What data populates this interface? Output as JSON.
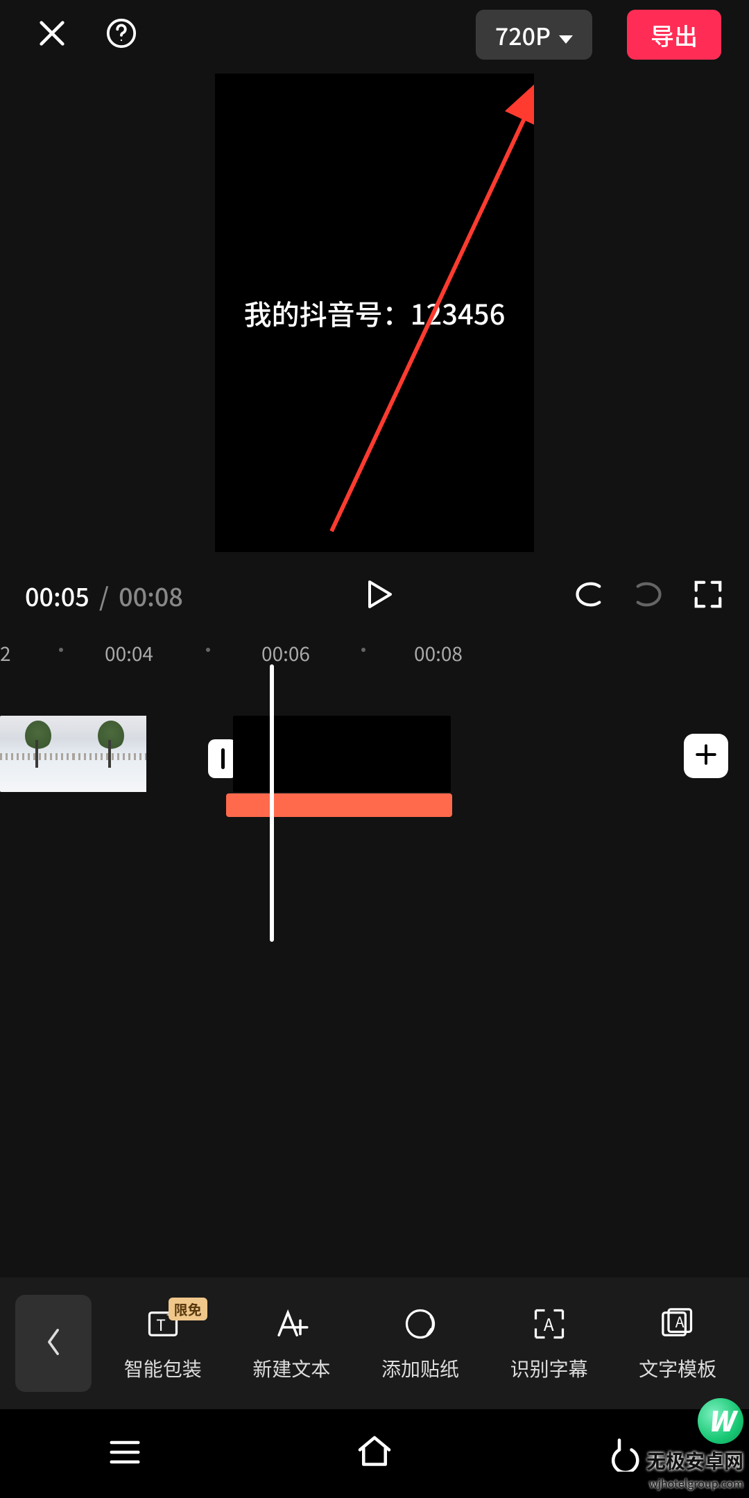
{
  "header": {
    "resolution_label": "720P",
    "export_label": "导出"
  },
  "preview": {
    "overlay_text": "我的抖音号：123456"
  },
  "playback": {
    "current_time": "00:05",
    "separator": "/",
    "total_time": "00:08"
  },
  "ruler": {
    "left_edge": "2",
    "marks": [
      "00:04",
      "00:06",
      "00:08"
    ]
  },
  "tools": {
    "badge_text": "限免",
    "items": [
      {
        "label": "智能包装"
      },
      {
        "label": "新建文本"
      },
      {
        "label": "添加贴纸"
      },
      {
        "label": "识别字幕"
      },
      {
        "label": "文字模板"
      }
    ]
  },
  "watermark": {
    "logo_letter": "W",
    "line1": "无极安卓网",
    "line2": "wjhotelgroup.com"
  }
}
